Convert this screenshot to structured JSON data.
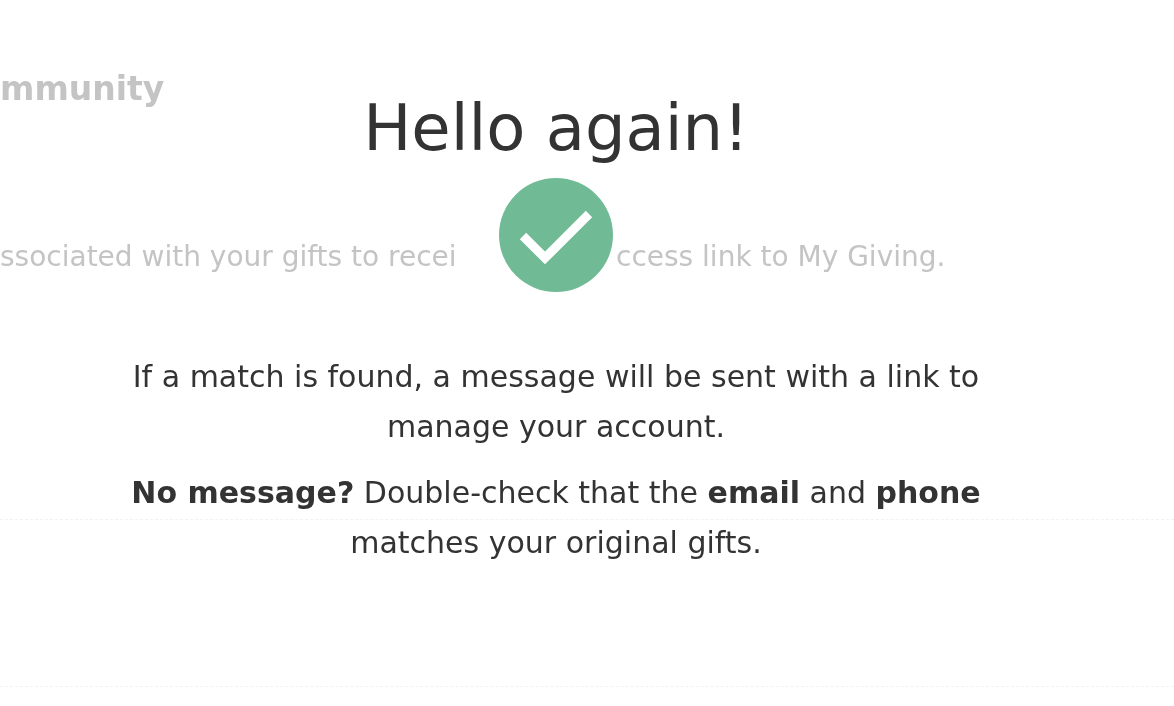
{
  "background": {
    "heading": "mmunity",
    "sentence_start": "ssociated with your gifts to recei",
    "sentence_end": "ccess link to My Giving."
  },
  "dialog": {
    "title": "Hello again!",
    "success": true,
    "message": "If a match is found, a message will be sent with a link to manage your account.",
    "hint": "**No message?** Double-check that the **email** and **phone** matches your original gifts."
  }
}
